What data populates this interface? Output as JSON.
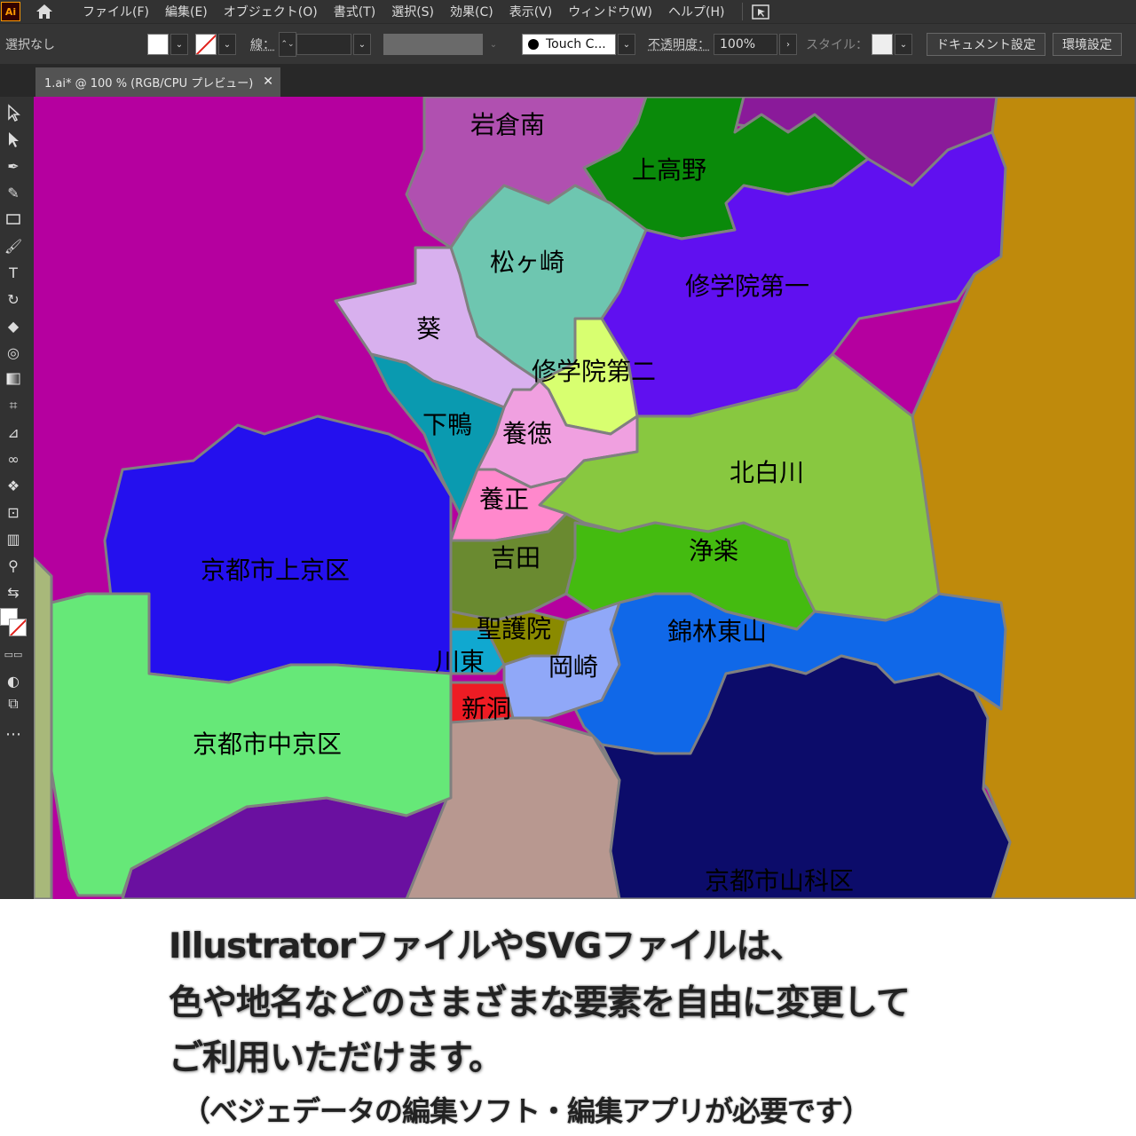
{
  "app": {
    "logo": "Ai",
    "accent": "#ff9a00"
  },
  "menu": [
    "ファイル(F)",
    "編集(E)",
    "オブジェクト(O)",
    "書式(T)",
    "選択(S)",
    "効果(C)",
    "表示(V)",
    "ウィンドウ(W)",
    "ヘルプ(H)"
  ],
  "control": {
    "selection": "選択なし",
    "stroke_label": "線：",
    "brush": "Touch C...",
    "opacity_label": "不透明度：",
    "opacity": "100%",
    "style_label": "スタイル：",
    "doc_settings": "ドキュメント設定",
    "preferences": "環境設定"
  },
  "tab": {
    "title": "1.ai* @ 100 % (RGB/CPU プレビュー)",
    "close": "✕"
  },
  "map": {
    "regions": [
      {
        "name": "岩倉南",
        "color": "#b050b0"
      },
      {
        "name": "上高野",
        "color": "#0a8a0a"
      },
      {
        "name": "松ヶ崎",
        "color": "#6ec6b0"
      },
      {
        "name": "修学院第一",
        "color": "#6010f0"
      },
      {
        "name": "葵",
        "color": "#d8b0ee"
      },
      {
        "name": "修学院第二",
        "color": "#d8ff70"
      },
      {
        "name": "下鴨",
        "color": "#0a9ab0"
      },
      {
        "name": "養徳",
        "color": "#f0a0e0"
      },
      {
        "name": "北白川",
        "color": "#88c840"
      },
      {
        "name": "養正",
        "color": "#ff88cc"
      },
      {
        "name": "京都市上京区",
        "color": "#2410ee"
      },
      {
        "name": "吉田",
        "color": "#6a8a30"
      },
      {
        "name": "浄楽",
        "color": "#44bb10"
      },
      {
        "name": "聖護院",
        "color": "#8a8a00"
      },
      {
        "name": "錦林東山",
        "color": "#1068e8"
      },
      {
        "name": "川東",
        "color": "#10a8d0"
      },
      {
        "name": "岡崎",
        "color": "#90a8f8"
      },
      {
        "name": "新洞",
        "color": "#ee1c24"
      },
      {
        "name": "京都市中京区",
        "color": "#66e878"
      },
      {
        "name": "京都市山科区",
        "color": "#0c0c6a"
      }
    ]
  },
  "caption": {
    "line1": "IllustratorファイルやSVGファイルは、",
    "line2": "色や地名などのさまざまな要素を自由に変更して",
    "line3": "ご利用いただけます。",
    "note": "（ベジェデータの編集ソフト・編集アプリが必要です）"
  }
}
